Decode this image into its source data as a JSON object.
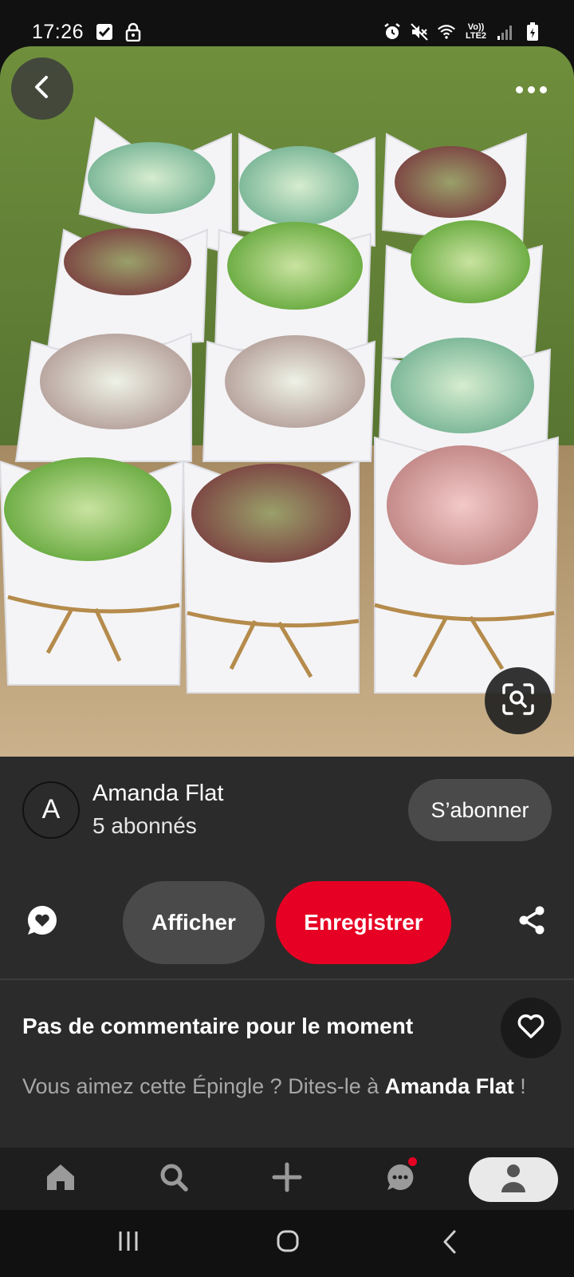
{
  "status_bar": {
    "time": "17:26",
    "icons": [
      "check-box-icon",
      "lock-icon",
      "alarm-icon",
      "mute-icon",
      "wifi-icon",
      "signal-icon",
      "battery-icon"
    ],
    "network_label": "Vo)) LTE2"
  },
  "pin": {
    "image_description_icons": [
      "back-icon",
      "more-icon",
      "visual-search-icon"
    ]
  },
  "author": {
    "initial": "A",
    "name": "Amanda Flat",
    "followers": "5 abonnés",
    "follow_label": "S’abonner"
  },
  "actions": {
    "view_label": "Afficher",
    "save_label": "Enregistrer"
  },
  "comments": {
    "title": "Pas de commentaire pour le moment",
    "prompt_prefix": "Vous aimez cette Épingle ? Dites-le à ",
    "prompt_name": "Amanda Flat",
    "prompt_suffix": " !"
  },
  "nav": {
    "items": [
      "home-icon",
      "search-icon",
      "create-icon",
      "messages-icon",
      "profile-icon"
    ]
  },
  "colors": {
    "accent": "#e60023",
    "panel_bg": "#2b2b2b",
    "button_bg": "#4a4a4a"
  }
}
